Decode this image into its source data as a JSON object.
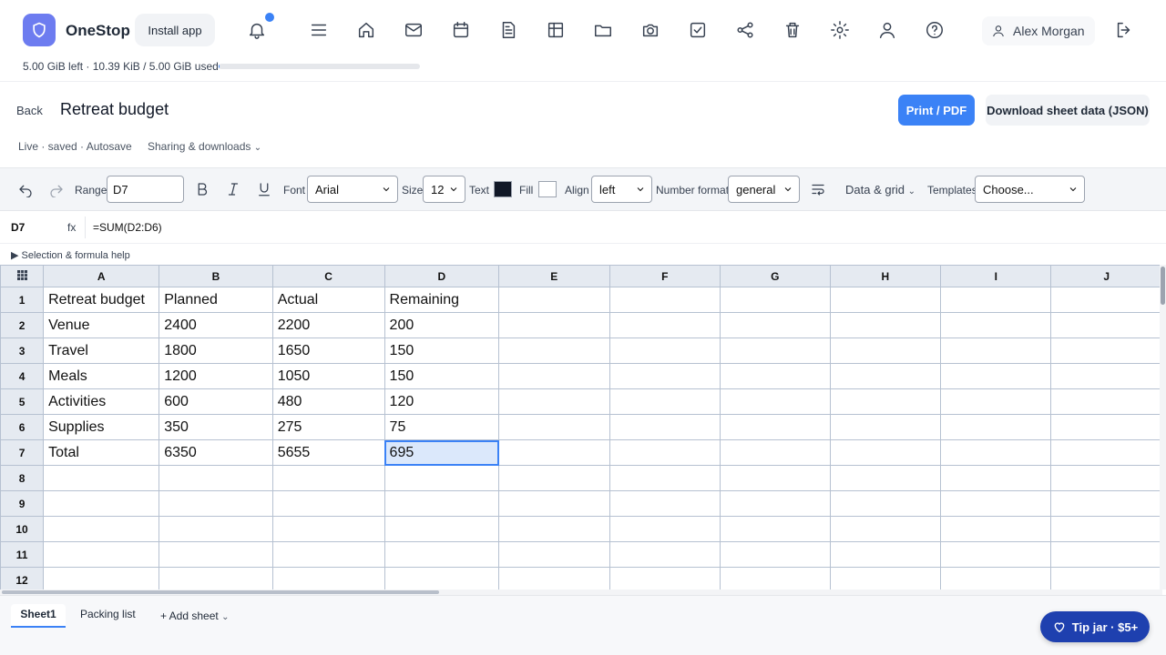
{
  "app": {
    "name": "OneStop",
    "install_label": "Install app",
    "user_name": "Alex Morgan",
    "storage_text": "5.00 GiB left · 10.39 KiB / 5.00 GiB used",
    "storage_used_fraction": 0.002
  },
  "doc": {
    "back_label": "Back",
    "title": "Retreat budget",
    "print_label": "Print / PDF",
    "download_label": "Download sheet data (JSON)",
    "status": "Live · saved · Autosave",
    "sharing_label": "Sharing & downloads"
  },
  "toolbar": {
    "range_label": "Range",
    "range_value": "D7",
    "font_label": "Font",
    "font_value": "Arial",
    "size_label": "Size",
    "size_value": "12",
    "text_label": "Text",
    "text_color": "#111827",
    "fill_label": "Fill",
    "fill_color": "#ffffff",
    "align_label": "Align",
    "align_value": "left",
    "number_format_label": "Number format",
    "number_format_value": "general",
    "data_grid_label": "Data & grid",
    "templates_label": "Templates",
    "templates_value": "Choose..."
  },
  "formula_bar": {
    "cell": "D7",
    "fx": "fx",
    "formula": "=SUM(D2:D6)",
    "help_label": "▶ Selection & formula help"
  },
  "grid": {
    "corner_icon": "grid-icon",
    "columns": [
      "A",
      "B",
      "C",
      "D",
      "E",
      "F",
      "G",
      "H",
      "I",
      "J"
    ],
    "rows": [
      [
        "Retreat budget",
        "Planned",
        "Actual",
        "Remaining",
        "",
        "",
        "",
        "",
        "",
        ""
      ],
      [
        "Venue",
        "2400",
        "2200",
        "200",
        "",
        "",
        "",
        "",
        "",
        ""
      ],
      [
        "Travel",
        "1800",
        "1650",
        "150",
        "",
        "",
        "",
        "",
        "",
        ""
      ],
      [
        "Meals",
        "1200",
        "1050",
        "150",
        "",
        "",
        "",
        "",
        "",
        ""
      ],
      [
        "Activities",
        "600",
        "480",
        "120",
        "",
        "",
        "",
        "",
        "",
        ""
      ],
      [
        "Supplies",
        "350",
        "275",
        "75",
        "",
        "",
        "",
        "",
        "",
        ""
      ],
      [
        "Total",
        "6350",
        "5655",
        "695",
        "",
        "",
        "",
        "",
        "",
        ""
      ],
      [
        "",
        "",
        "",
        "",
        "",
        "",
        "",
        "",
        "",
        ""
      ],
      [
        "",
        "",
        "",
        "",
        "",
        "",
        "",
        "",
        "",
        ""
      ],
      [
        "",
        "",
        "",
        "",
        "",
        "",
        "",
        "",
        "",
        ""
      ],
      [
        "",
        "",
        "",
        "",
        "",
        "",
        "",
        "",
        "",
        ""
      ],
      [
        "",
        "",
        "",
        "",
        "",
        "",
        "",
        "",
        "",
        ""
      ]
    ],
    "row_numbers": [
      "1",
      "2",
      "3",
      "4",
      "5",
      "6",
      "7",
      "8",
      "9",
      "10",
      "11",
      "12"
    ],
    "selected": {
      "row": 7,
      "col": "D"
    }
  },
  "sheets": {
    "tabs": [
      "Sheet1",
      "Packing list"
    ],
    "active": "Sheet1",
    "add_label": "+ Add sheet"
  },
  "tip": {
    "label": "Tip jar · $5+"
  },
  "colors": {
    "accent": "#3b82f6",
    "logo": "#6d7cf0",
    "tip": "#1e40af"
  }
}
